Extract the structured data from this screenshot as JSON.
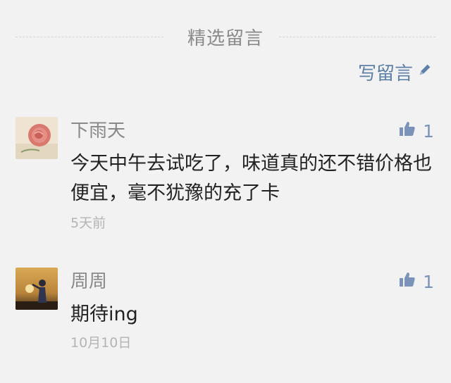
{
  "section": {
    "title": "精选留言"
  },
  "write_button": {
    "label": "写留言",
    "icon": "pencil-icon"
  },
  "comments": [
    {
      "nickname": "下雨天",
      "likes": "1",
      "content": "今天中午去试吃了，味道真的还不错价格也便宜，毫不犹豫的充了卡",
      "time": "5天前",
      "avatar": "rose-avatar"
    },
    {
      "nickname": "周周",
      "likes": "1",
      "content": "期待ing",
      "time": "10月10日",
      "avatar": "sunset-silhouette-avatar"
    }
  ],
  "colors": {
    "background": "#f2f2f2",
    "link": "#5e7fa6",
    "like": "#7b93b8",
    "nickname": "#888888",
    "content": "#222222",
    "time": "#b4b4b4"
  }
}
